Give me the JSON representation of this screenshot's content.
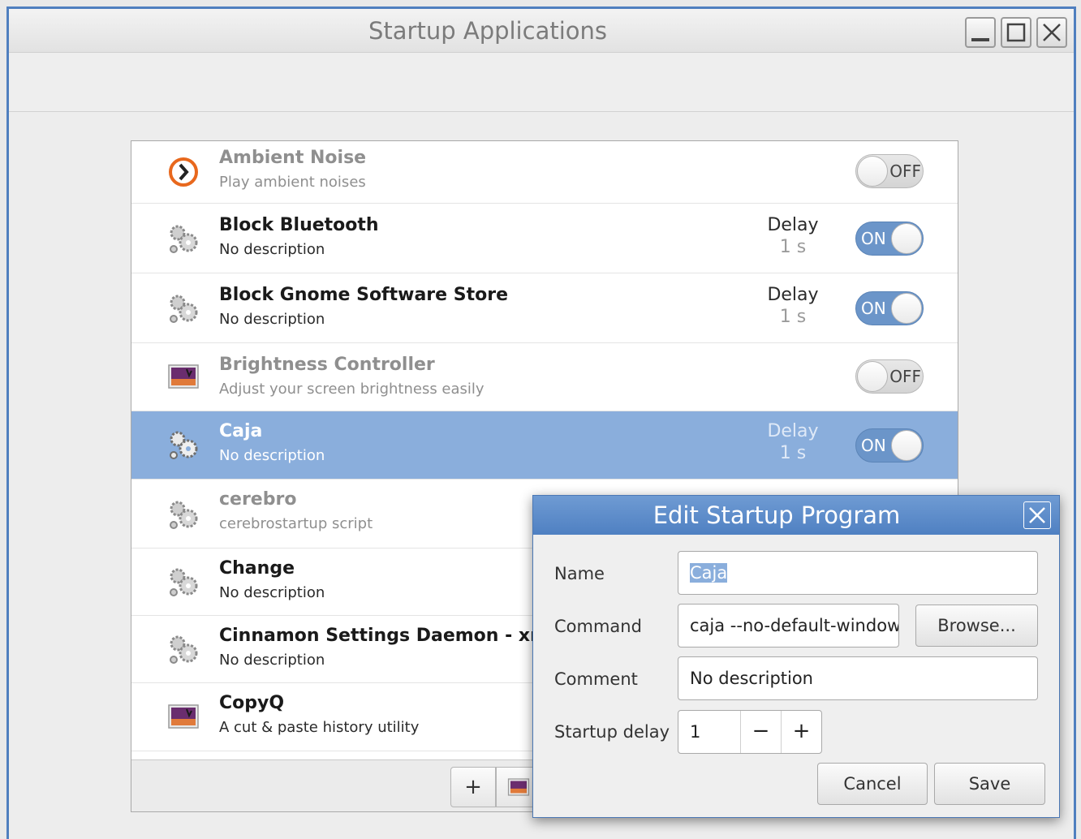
{
  "window": {
    "title": "Startup Applications"
  },
  "list": {
    "items": [
      {
        "name": "Ambient Noise",
        "desc": "Play ambient noises",
        "delay_label": "",
        "delay_value": "",
        "enabled": false,
        "switch_text": "OFF",
        "icon": "ambient-noise-icon"
      },
      {
        "name": "Block Bluetooth",
        "desc": "No description",
        "delay_label": "Delay",
        "delay_value": "1 s",
        "enabled": true,
        "switch_text": "ON",
        "icon": "gears-icon"
      },
      {
        "name": "Block Gnome Software Store",
        "desc": "No description",
        "delay_label": "Delay",
        "delay_value": "1 s",
        "enabled": true,
        "switch_text": "ON",
        "icon": "gears-icon"
      },
      {
        "name": "Brightness Controller",
        "desc": "Adjust your screen brightness easily",
        "delay_label": "",
        "delay_value": "",
        "enabled": false,
        "switch_text": "OFF",
        "icon": "image-icon"
      },
      {
        "name": "Caja",
        "desc": "No description",
        "delay_label": "Delay",
        "delay_value": "1 s",
        "enabled": true,
        "switch_text": "ON",
        "icon": "gears-icon",
        "selected": true
      },
      {
        "name": "cerebro",
        "desc": "cerebrostartup script",
        "delay_label": "",
        "delay_value": "",
        "enabled": false,
        "switch_text": "",
        "icon": "gears-icon"
      },
      {
        "name": "Change",
        "desc": "No description",
        "delay_label": "",
        "delay_value": "",
        "enabled": true,
        "switch_text": "",
        "icon": "gears-icon"
      },
      {
        "name": "Cinnamon Settings Daemon - xrandr",
        "desc": "No description",
        "delay_label": "",
        "delay_value": "",
        "enabled": true,
        "switch_text": "",
        "icon": "gears-icon"
      },
      {
        "name": "CopyQ",
        "desc": "A cut & paste history utility",
        "delay_label": "",
        "delay_value": "",
        "enabled": true,
        "switch_text": "",
        "icon": "image-icon"
      }
    ],
    "footer": {
      "add_label": "+"
    }
  },
  "dialog": {
    "title": "Edit Startup Program",
    "name_label": "Name",
    "name_value": "Caja",
    "command_label": "Command",
    "command_value": "caja --no-default-window",
    "browse_label": "Browse...",
    "comment_label": "Comment",
    "comment_value": "No description",
    "delay_label": "Startup delay",
    "delay_value": "1",
    "minus_label": "−",
    "plus_label": "+",
    "cancel_label": "Cancel",
    "save_label": "Save"
  },
  "colors": {
    "accent": "#4f80c2",
    "selection": "#8aaedc",
    "switch_on": "#6b95c9"
  }
}
